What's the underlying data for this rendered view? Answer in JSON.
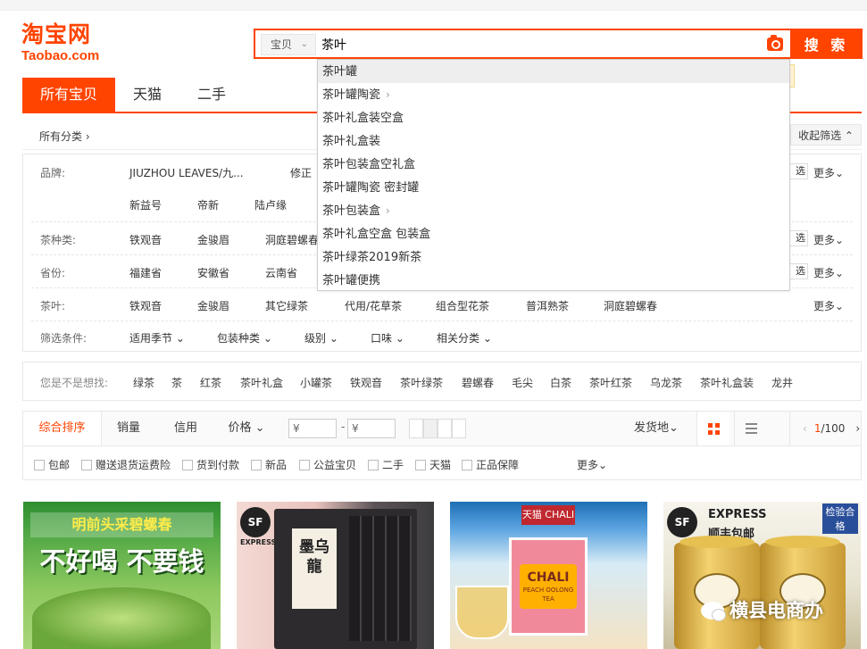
{
  "logo": {
    "cn": "淘宝网",
    "en": "Taobao.com"
  },
  "search": {
    "type": "宝贝",
    "query": "茶叶",
    "button": "搜 索",
    "suggestions": [
      {
        "text": "茶叶罐",
        "arrow": ""
      },
      {
        "text": "茶叶罐陶瓷",
        "arrow": "›"
      },
      {
        "text": "茶叶礼盒装空盒",
        "arrow": ""
      },
      {
        "text": "茶叶礼盒装",
        "arrow": ""
      },
      {
        "text": "茶叶包装盒空礼盒",
        "arrow": ""
      },
      {
        "text": "茶叶罐陶瓷 密封罐",
        "arrow": ""
      },
      {
        "text": "茶叶包装盒",
        "arrow": "›"
      },
      {
        "text": "茶叶礼盒空盒 包装盒",
        "arrow": ""
      },
      {
        "text": "茶叶绿茶2019新茶",
        "arrow": ""
      },
      {
        "text": "茶叶罐便携",
        "arrow": ""
      }
    ]
  },
  "tabs": [
    "所有宝贝",
    "天猫",
    "二手"
  ],
  "category": {
    "all": "所有分类 ›",
    "collapse": "收起筛选 ⌃"
  },
  "filters": {
    "brand": {
      "label": "品牌:",
      "values": [
        "JIUZHOU LEAVES/九...",
        "修正",
        "新益号",
        "帝新",
        "陆卢缘"
      ],
      "more": "更多⌄",
      "multi": "选"
    },
    "tea_type": {
      "label": "茶种类:",
      "values": [
        "铁观音",
        "金骏眉",
        "洞庭碧螺春"
      ],
      "more": "更多⌄",
      "multi": "选"
    },
    "province": {
      "label": "省份:",
      "values": [
        "福建省",
        "安徽省",
        "云南省"
      ],
      "more": "更多⌄",
      "multi": "选"
    },
    "tea": {
      "label": "茶叶:",
      "values": [
        "铁观音",
        "金骏眉",
        "其它绿茶",
        "代用/花草茶",
        "组合型花茶",
        "普洱熟茶",
        "洞庭碧螺春"
      ],
      "more": "更多⌄"
    },
    "conditions": {
      "label": "筛选条件:",
      "values": [
        "适用季节 ⌄",
        "包装种类 ⌄",
        "级别 ⌄",
        "口味 ⌄",
        "相关分类 ⌄"
      ]
    }
  },
  "guess": {
    "label": "您是不是想找:",
    "words": [
      "绿茶",
      "茶",
      "红茶",
      "茶叶礼盒",
      "小罐茶",
      "铁观音",
      "茶叶绿茶",
      "碧螺春",
      "毛尖",
      "白茶",
      "茶叶红茶",
      "乌龙茶",
      "茶叶礼盒装",
      "龙井"
    ]
  },
  "sort": {
    "items": [
      "综合排序",
      "销量",
      "信用",
      "价格 ⌄"
    ],
    "price_min": "¥",
    "price_max": "¥",
    "dash": "-",
    "ship": "发货地⌄",
    "page_current": "1",
    "page_total": "/100",
    "prev": "‹",
    "next": "›"
  },
  "checks": [
    "包邮",
    "赠送退货运费险",
    "货到付款",
    "新品",
    "公益宝贝",
    "二手",
    "天猫",
    "正品保障"
  ],
  "checks_more": "更多⌄",
  "products": {
    "p1": {
      "band": "明前头采碧螺春",
      "big": "不好喝 不要钱"
    },
    "p2": {
      "badge": "SF",
      "express": "EXPRESS 顺丰包邮",
      "label": "墨乌龍"
    },
    "p3": {
      "top": "天猫 CHALI",
      "chali": "CHALI",
      "sub": "PEACH OOLONG TEA"
    },
    "p4": {
      "top": "EXPRESS 顺丰包邮",
      "stamp": "检验合格"
    }
  },
  "watermark": "横县电商办",
  "colors": {
    "accent": "#ff4400"
  }
}
